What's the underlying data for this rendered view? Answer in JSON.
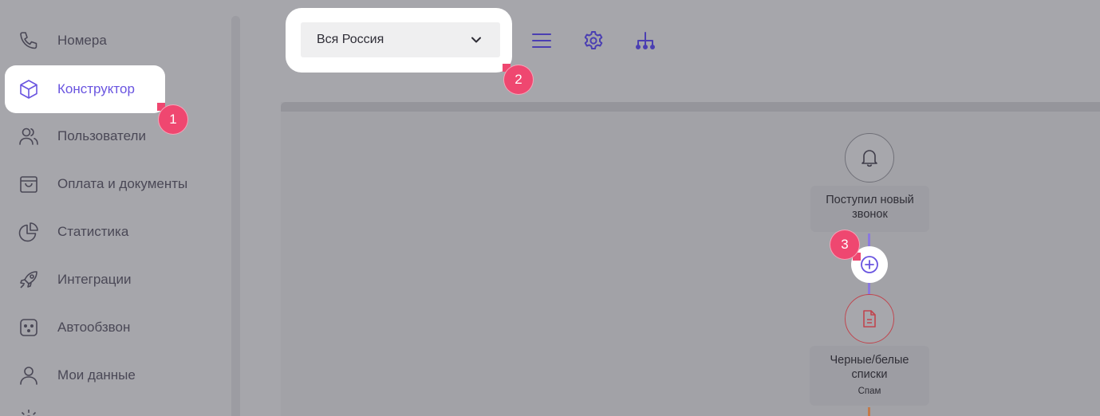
{
  "sidebar": {
    "items": [
      {
        "label": "Номера",
        "icon": "phone-icon"
      },
      {
        "label": "Конструктор",
        "icon": "cube-icon",
        "active": true
      },
      {
        "label": "Пользователи",
        "icon": "users-icon"
      },
      {
        "label": "Оплата и документы",
        "icon": "shopping-bag-icon"
      },
      {
        "label": "Статистика",
        "icon": "pie-chart-icon"
      },
      {
        "label": "Интеграции",
        "icon": "rocket-icon"
      },
      {
        "label": "Автообзвон",
        "icon": "robot-icon"
      },
      {
        "label": "Мои данные",
        "icon": "user-icon"
      }
    ]
  },
  "toolbar": {
    "region_value": "Вся Россия",
    "buttons": [
      "menu-icon",
      "gear-icon",
      "hierarchy-icon"
    ]
  },
  "badges": {
    "one": "1",
    "two": "2",
    "three": "3"
  },
  "flow": {
    "trigger_title": "Поступил новый звонок",
    "list_title": "Черные/белые списки",
    "list_subtitle": "Спам"
  },
  "colors": {
    "accent": "#6a55e0",
    "badge": "#ef4770",
    "connector_top": "#8a78e0",
    "connector_bottom": "#c27a4a",
    "list_node": "#c0454e"
  }
}
